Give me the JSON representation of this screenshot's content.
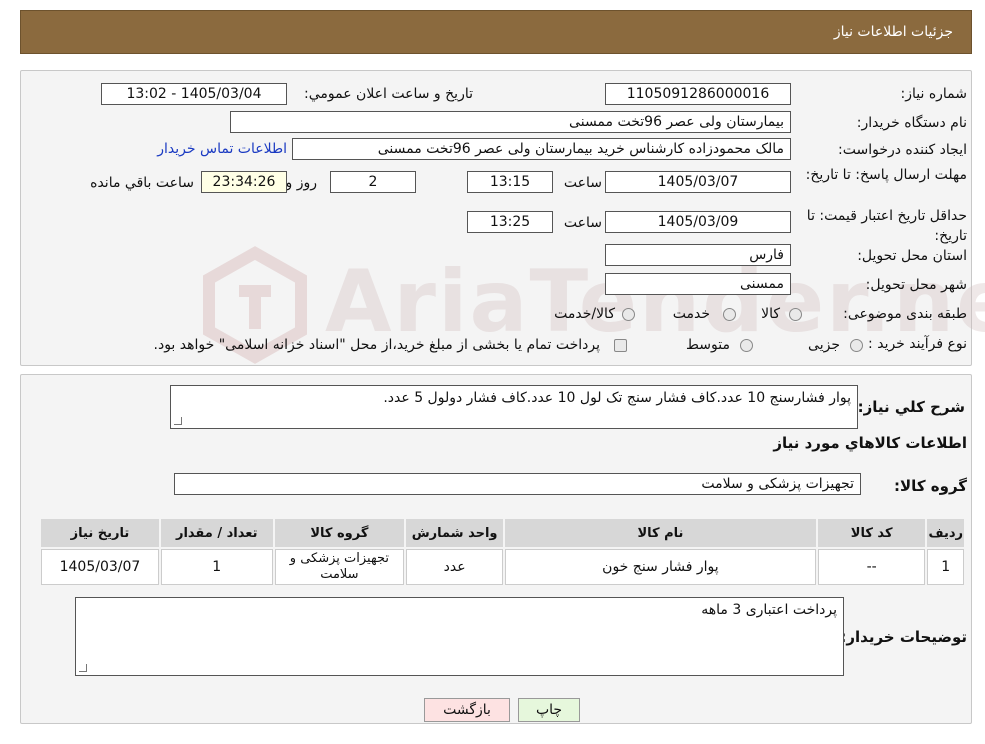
{
  "header": {
    "title": "جزئیات اطلاعات نیاز"
  },
  "form": {
    "need_number_label": "شماره نیاز:",
    "need_number": "1105091286000016",
    "announce_label": "تاریخ و ساعت اعلان عمومي:",
    "announce_value": "1405/03/04 - 13:02",
    "buyer_org_label": "نام دستگاه خريدار:",
    "buyer_org": "بیمارستان ولی عصر  96تخت ممسنی",
    "creator_label": "ایجاد کننده درخواست:",
    "creator": "مالک محمودزاده کارشناس خرید بیمارستان ولی عصر  96تخت ممسنی",
    "contact_link": "اطلاعات تماس خریدار",
    "reply_deadline_label": "مهلت ارسال پاسخ: تا تاریخ:",
    "reply_date": "1405/03/07",
    "time_label": "ساعت",
    "reply_time": "13:15",
    "days": "2",
    "days_label": "روز و",
    "remaining_time": "23:34:26",
    "remaining_label": "ساعت باقي مانده",
    "price_validity_label": "حداقل تاریخ اعتبار قیمت: تا تاریخ:",
    "price_date": "1405/03/09",
    "price_time": "13:25",
    "province_label": "استان محل تحویل:",
    "province": "فارس",
    "city_label": "شهر محل تحویل:",
    "city": "ممسنی",
    "category_label": "طبقه بندی موضوعی:",
    "category_options": [
      "کالا",
      "خدمت",
      "کالا/خدمت"
    ],
    "process_label": "نوع فرآیند خرید :",
    "process_options": [
      "جزیی",
      "متوسط"
    ],
    "process_note": "پرداخت تمام یا بخشی از مبلغ خرید،از محل \"اسناد خزانه اسلامی\" خواهد بود."
  },
  "details": {
    "desc_label": "شرح كلي نياز:",
    "desc": "پوار فشارسنج 10 عدد.کاف فشار سنج تک لول 10 عدد.کاف فشار دولول 5 عدد.",
    "goods_info_title": "اطلاعات کالاهاي مورد نياز",
    "group_label": "گروه کالا:",
    "group_value": "تجهیزات پزشکی و سلامت",
    "table_headers": [
      "رديف",
      "کد کالا",
      "نام کالا",
      "واحد شمارش",
      "گروه کالا",
      "تعداد / مقدار",
      "تاریخ نیاز"
    ],
    "rows": [
      [
        "1",
        "--",
        "پوار فشار سنج خون",
        "عدد",
        "تجهیزات پزشکی و سلامت",
        "1",
        "1405/03/07"
      ]
    ],
    "buyer_notes_label": "توضیحات خریدار:",
    "buyer_notes": "پرداخت اعتباری 3 ماهه"
  },
  "buttons": {
    "print": "چاپ",
    "back": "بازگشت"
  },
  "watermark": "AriaTender.neT",
  "colors": {
    "header_bg": "#8b6a3e",
    "link": "#1a3ac2",
    "back_button": "#fde2e2",
    "print_button": "#e6f7dc"
  }
}
